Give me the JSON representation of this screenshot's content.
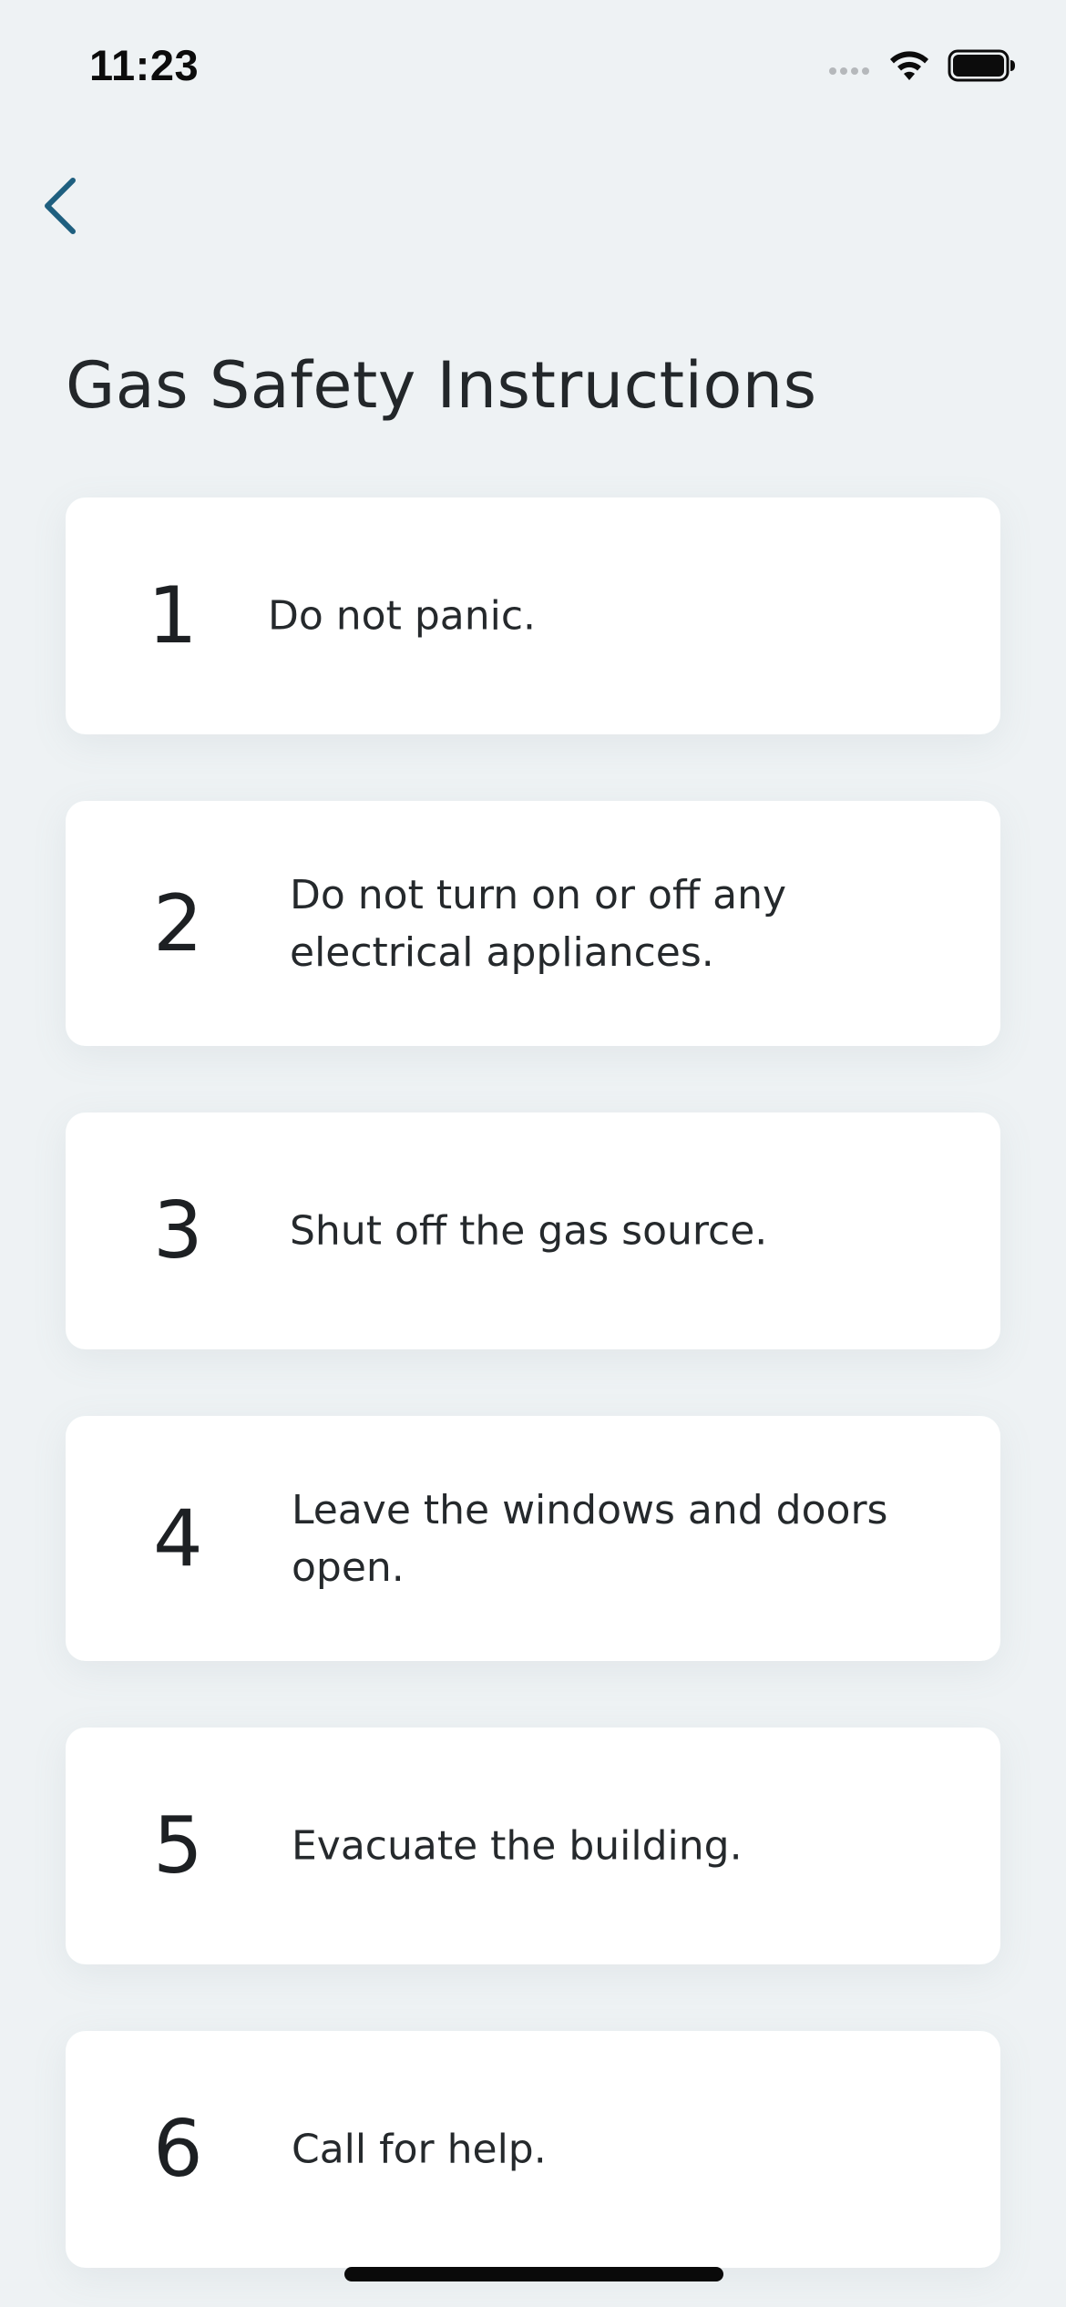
{
  "status_bar": {
    "time": "11:23",
    "signal_icon": "cellular-signal-dots-icon",
    "wifi_icon": "wifi-icon",
    "battery_icon": "battery-full-icon"
  },
  "nav": {
    "back_icon": "chevron-left-icon",
    "accent_color": "#1e5f7f"
  },
  "page": {
    "title": "Gas Safety Instructions",
    "background_color": "#eef2f4"
  },
  "instructions": [
    {
      "number": "1",
      "text": "Do not panic."
    },
    {
      "number": "2",
      "text": "Do not turn on or off any electrical appliances."
    },
    {
      "number": "3",
      "text": "Shut off the gas source."
    },
    {
      "number": "4",
      "text": "Leave the windows and doors open."
    },
    {
      "number": "5",
      "text": "Evacuate the building."
    },
    {
      "number": "6",
      "text": "Call for help."
    }
  ]
}
